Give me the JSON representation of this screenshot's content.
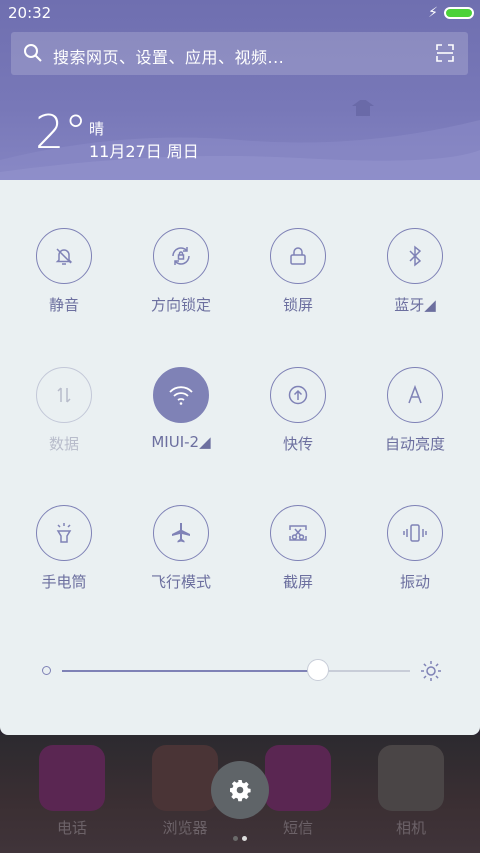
{
  "status_bar": {
    "time": "20:32",
    "battery_icon": "battery-full-icon",
    "charging_icon": "bolt-icon"
  },
  "search": {
    "placeholder": "搜索网页、设置、应用、视频..."
  },
  "weather": {
    "temperature": "2°",
    "condition": "晴",
    "date": "11月27日 周日"
  },
  "toggles": [
    {
      "label": "静音",
      "icon": "bell-mute-icon",
      "state": "off"
    },
    {
      "label": "方向锁定",
      "icon": "rotation-lock-icon",
      "state": "off"
    },
    {
      "label": "锁屏",
      "icon": "lock-icon",
      "state": "off"
    },
    {
      "label": "蓝牙◢",
      "icon": "bluetooth-icon",
      "state": "off"
    },
    {
      "label": "数据",
      "icon": "data-icon",
      "state": "disabled"
    },
    {
      "label": "MIUI-2◢",
      "icon": "wifi-icon",
      "state": "on"
    },
    {
      "label": "快传",
      "icon": "upload-icon",
      "state": "off"
    },
    {
      "label": "自动亮度",
      "icon": "auto-brightness-icon",
      "state": "off"
    },
    {
      "label": "手电筒",
      "icon": "flashlight-icon",
      "state": "off"
    },
    {
      "label": "飞行模式",
      "icon": "airplane-icon",
      "state": "off"
    },
    {
      "label": "截屏",
      "icon": "screenshot-icon",
      "state": "off"
    },
    {
      "label": "振动",
      "icon": "vibrate-icon",
      "state": "off"
    }
  ],
  "brightness": {
    "level_fraction": 0.735
  },
  "dock": [
    {
      "label": "电话",
      "icon": "phone-icon",
      "color": "#5a2652"
    },
    {
      "label": "浏览器",
      "icon": "browser-icon",
      "color": "#4a3436"
    },
    {
      "label": "短信",
      "icon": "message-icon",
      "color": "#5a2652"
    },
    {
      "label": "相机",
      "icon": "camera-icon",
      "color": "#4a4546"
    }
  ],
  "pager": {
    "pages": 2,
    "current": 2
  },
  "colors": {
    "accent": "#7f82b6",
    "panel_bg": "#eaf0f2",
    "header_bg": "#7878b8"
  }
}
